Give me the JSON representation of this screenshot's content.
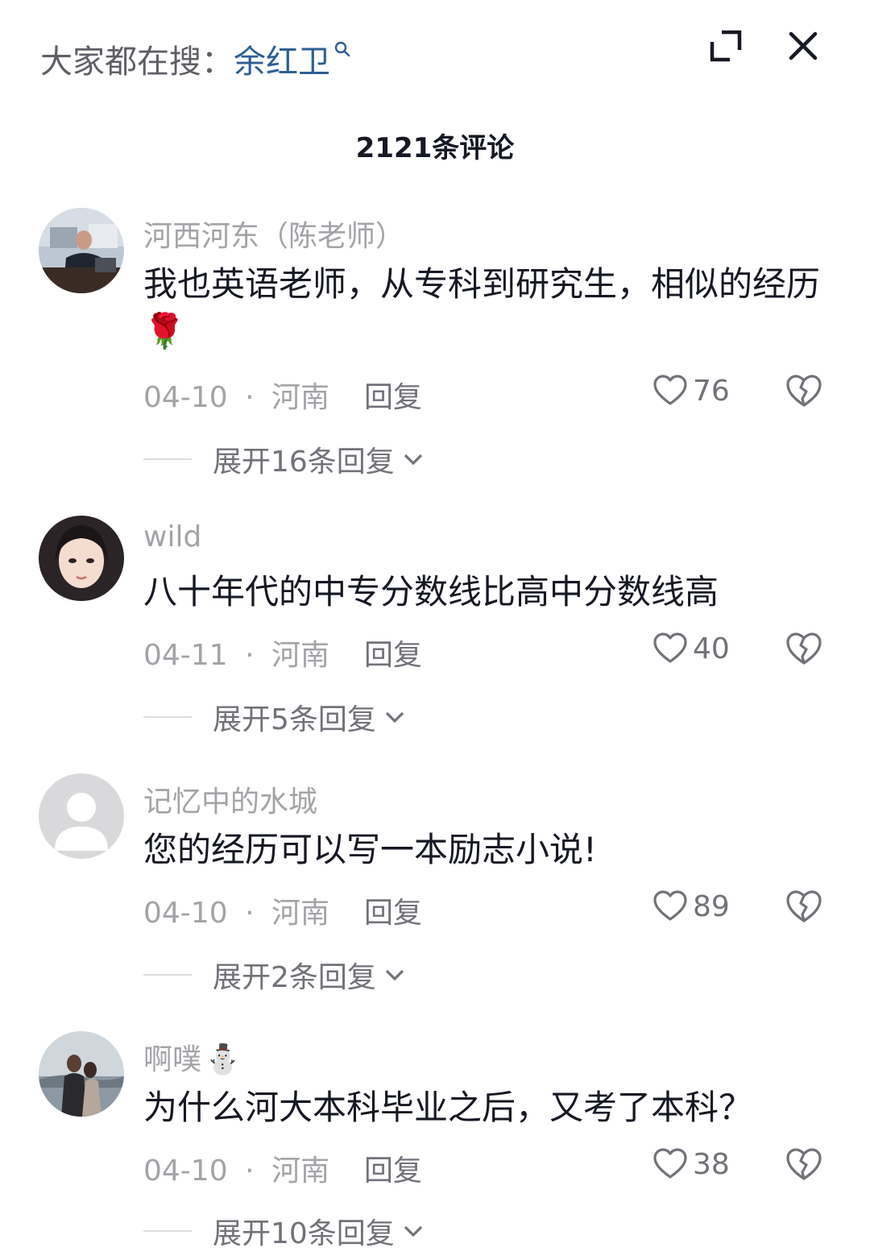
{
  "header": {
    "search_prefix": "大家都在搜：",
    "search_term": "余红卫",
    "expand_icon": "expand-icon",
    "close_icon": "close-icon"
  },
  "comment_count": "2121条评论",
  "comments": [
    {
      "username": "河西河东（陈老师）",
      "text": "我也英语老师，从专科到研究生，相似的经历",
      "emoji": "🌹",
      "date": "04-10",
      "separator": "·",
      "location": "河南",
      "reply_label": "回复",
      "likes": "76",
      "expand_label": "展开16条回复"
    },
    {
      "username": "wild",
      "text": "八十年代的中专分数线比高中分数线高",
      "date": "04-11",
      "separator": "·",
      "location": "河南",
      "reply_label": "回复",
      "likes": "40",
      "expand_label": "展开5条回复"
    },
    {
      "username": "记忆中的水城",
      "text": "您的经历可以写一本励志小说!",
      "date": "04-10",
      "separator": "·",
      "location": "河南",
      "reply_label": "回复",
      "likes": "89",
      "expand_label": "展开2条回复"
    },
    {
      "username": "啊噗",
      "username_emoji": "⛄",
      "text": "为什么河大本科毕业之后，又考了本科？",
      "date": "04-10",
      "separator": "·",
      "location": "河南",
      "reply_label": "回复",
      "likes": "38",
      "expand_label": "展开10条回复"
    }
  ],
  "colors": {
    "text_primary": "#161823",
    "text_secondary": "#a3a4a8",
    "action_text": "#717279",
    "search_term": "#2d5f94"
  }
}
